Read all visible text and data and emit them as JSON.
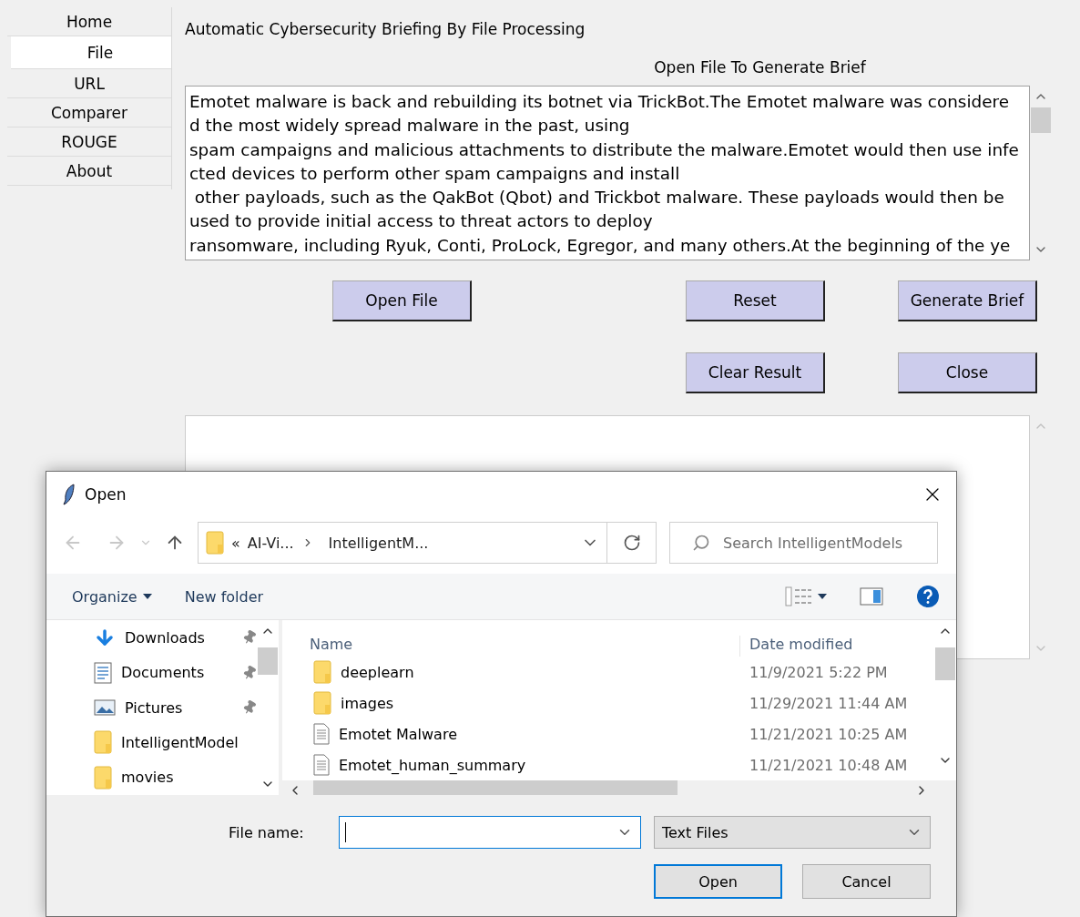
{
  "sidebar": {
    "tabs": [
      {
        "label": "Home",
        "selected": false
      },
      {
        "label": "File",
        "selected": true
      },
      {
        "label": "URL",
        "selected": false
      },
      {
        "label": "Comparer",
        "selected": false
      },
      {
        "label": "ROUGE",
        "selected": false
      },
      {
        "label": "About",
        "selected": false
      }
    ]
  },
  "main": {
    "title": "Automatic Cybersecurity Briefing By File Processing",
    "subtitle": "Open File To Generate Brief",
    "input_lines": [
      "Emotet malware is back and rebuilding its botnet via TrickBot.The Emotet malware was considere",
      "d the most widely spread malware in the past, using",
      "spam campaigns and malicious attachments to distribute the malware.Emotet would then use infe",
      "cted devices to perform other spam campaigns and install",
      " other payloads, such as the QakBot (Qbot) and Trickbot malware. These payloads would then be",
      "used to provide initial access to threat actors to deploy",
      "ransomware, including Ryuk, Conti, ProLock, Egregor, and many others.At the beginning of the ye"
    ],
    "buttons_row1": [
      "Open File",
      "Reset",
      "Generate Brief"
    ],
    "buttons_row2": [
      "Clear Result",
      "Close"
    ]
  },
  "dialog": {
    "title": "Open",
    "breadcrumb": {
      "overflow": "«",
      "parts": [
        "AI-Vi...",
        "IntelligentM..."
      ]
    },
    "search": {
      "placeholder": "Search IntelligentModels"
    },
    "toolbar": [
      "Organize",
      "New folder"
    ],
    "nav_items": [
      {
        "label": "Downloads",
        "kind": "downloads",
        "pinned": true
      },
      {
        "label": "Documents",
        "kind": "documents",
        "pinned": true
      },
      {
        "label": "Pictures",
        "kind": "pictures",
        "pinned": true
      },
      {
        "label": "IntelligentModel",
        "kind": "folder",
        "pinned": false
      },
      {
        "label": "movies",
        "kind": "folder",
        "pinned": false
      }
    ],
    "columns": [
      "Name",
      "Date modified"
    ],
    "files": [
      {
        "name": "deeplearn",
        "date": "11/9/2021 5:22 PM",
        "kind": "folder"
      },
      {
        "name": "images",
        "date": "11/29/2021 11:44 AM",
        "kind": "folder"
      },
      {
        "name": "Emotet Malware",
        "date": "11/21/2021 10:25 AM",
        "kind": "file"
      },
      {
        "name": "Emotet_human_summary",
        "date": "11/21/2021 10:48 AM",
        "kind": "file"
      }
    ],
    "file_name_label": "File name:",
    "file_type": "Text Files",
    "buttons": [
      "Open",
      "Cancel"
    ]
  }
}
